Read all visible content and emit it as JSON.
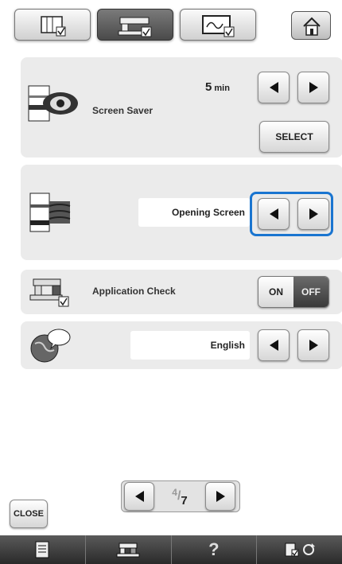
{
  "screen_saver": {
    "label": "Screen Saver",
    "time_value": "5",
    "time_unit": "min",
    "select_label": "SELECT"
  },
  "opening_screen": {
    "value": "Opening Screen"
  },
  "application_check": {
    "label": "Application Check",
    "on_label": "ON",
    "off_label": "OFF"
  },
  "language": {
    "value": "English"
  },
  "pagination": {
    "current": "4",
    "total": "7"
  },
  "footer": {
    "close_label": "CLOSE",
    "help_label": "?"
  },
  "colors": {
    "highlight": "#1a75d0",
    "panel": "#ebebeb",
    "bottom_bar": "#1b1b1b"
  }
}
